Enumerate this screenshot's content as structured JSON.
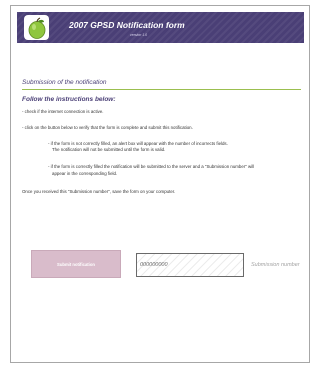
{
  "header": {
    "title": "2007 GPSD Notification form",
    "version": "version 1.0",
    "logo_icon": "green-apple-icon",
    "brand_color": "#4a3f76"
  },
  "section": {
    "title": "Submission of the notification",
    "rule_color": "#9bbf4f"
  },
  "instructions": {
    "heading": "Follow the instructions below:",
    "step1": "- check if the internet connection is active.",
    "step2": "- click on the button below to verify that the form is complete and submit this notification.",
    "note1_line1": "- if the form is not correctly filled, an alert box will appear with the number of incorrects fields.",
    "note1_line2": "The notification will not be submitted until the form is valid.",
    "note2_line1": "- if the form is correctly filled the notification will be submitted to the server and a \"Submission number\" will",
    "note2_line2": "appear in the corresponding field.",
    "closing": "Once you received this \"Submission number\", save the form on your computer."
  },
  "actions": {
    "submit_label": "Submit notification",
    "button_color": "#d9bccb"
  },
  "submission": {
    "value": "000000000",
    "label": "Submission number"
  }
}
